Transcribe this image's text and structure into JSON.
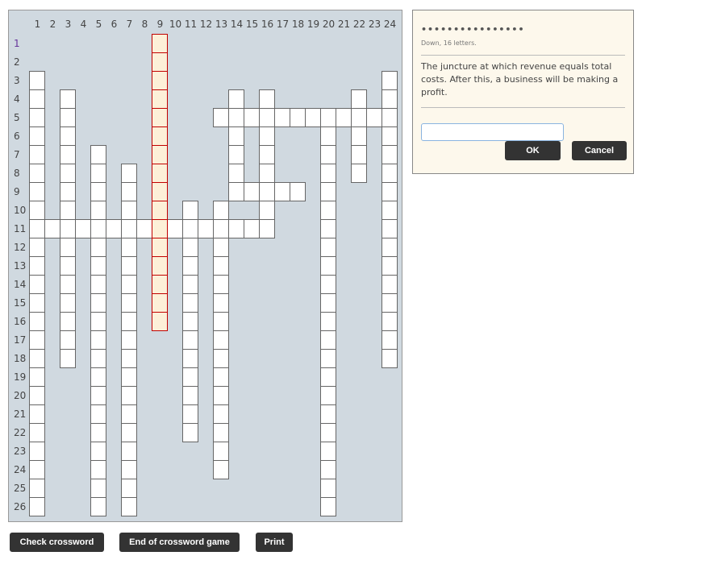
{
  "grid": {
    "columns": 24,
    "rows": 26,
    "words": [
      {
        "dir": "down",
        "col": 1,
        "row": 3,
        "len": 24
      },
      {
        "dir": "down",
        "col": 3,
        "row": 4,
        "len": 15
      },
      {
        "dir": "down",
        "col": 5,
        "row": 7,
        "len": 20
      },
      {
        "dir": "down",
        "col": 7,
        "row": 8,
        "len": 19
      },
      {
        "dir": "down",
        "col": 9,
        "row": 1,
        "len": 16,
        "selected": true
      },
      {
        "dir": "down",
        "col": 11,
        "row": 10,
        "len": 13
      },
      {
        "dir": "down",
        "col": 13,
        "row": 10,
        "len": 15
      },
      {
        "dir": "down",
        "col": 14,
        "row": 4,
        "len": 6
      },
      {
        "dir": "down",
        "col": 16,
        "row": 4,
        "len": 8
      },
      {
        "dir": "down",
        "col": 20,
        "row": 5,
        "len": 22
      },
      {
        "dir": "down",
        "col": 22,
        "row": 4,
        "len": 5
      },
      {
        "dir": "down",
        "col": 24,
        "row": 3,
        "len": 16
      },
      {
        "dir": "across",
        "col": 13,
        "row": 5,
        "len": 12
      },
      {
        "dir": "across",
        "col": 14,
        "row": 9,
        "len": 5
      },
      {
        "dir": "across",
        "col": 1,
        "row": 11,
        "len": 16
      }
    ],
    "highlight_color": "#c00000"
  },
  "clue": {
    "mask": "••••••••••••••••",
    "info": "Down, 16 letters.",
    "text": "The juncture at which revenue equals total costs. After this, a business will be making a profit.",
    "answer_value": "",
    "ok_label": "OK",
    "cancel_label": "Cancel"
  },
  "buttons": {
    "check": "Check crossword",
    "end": "End of crossword game",
    "print": "Print"
  }
}
